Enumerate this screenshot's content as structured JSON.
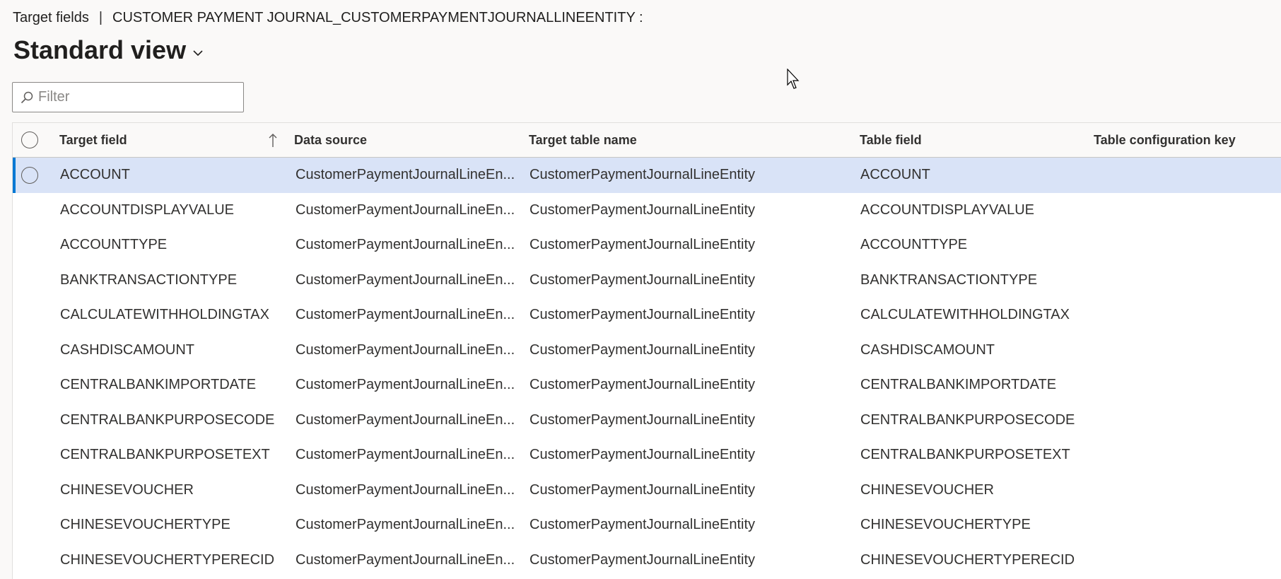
{
  "header": {
    "breadcrumb_first": "Target fields",
    "breadcrumb_separator": "|",
    "breadcrumb_second": "CUSTOMER PAYMENT JOURNAL_CUSTOMERPAYMENTJOURNALLINEENTITY :",
    "view_name": "Standard view"
  },
  "filter": {
    "placeholder": "Filter",
    "value": ""
  },
  "colors": {
    "selected_row": "#d9e3f7",
    "accent": "#0078d4"
  },
  "grid": {
    "columns": [
      "Target field",
      "Data source",
      "Target table name",
      "Table field",
      "Table configuration key"
    ],
    "sorted_column": "Target field",
    "sort_direction": "ascending",
    "rows": [
      {
        "target_field": "ACCOUNT",
        "data_source": "CustomerPaymentJournalLineEn...",
        "target_table": "CustomerPaymentJournalLineEntity",
        "table_field": "ACCOUNT",
        "config_key": "",
        "selected": true
      },
      {
        "target_field": "ACCOUNTDISPLAYVALUE",
        "data_source": "CustomerPaymentJournalLineEn...",
        "target_table": "CustomerPaymentJournalLineEntity",
        "table_field": "ACCOUNTDISPLAYVALUE",
        "config_key": ""
      },
      {
        "target_field": "ACCOUNTTYPE",
        "data_source": "CustomerPaymentJournalLineEn...",
        "target_table": "CustomerPaymentJournalLineEntity",
        "table_field": "ACCOUNTTYPE",
        "config_key": ""
      },
      {
        "target_field": "BANKTRANSACTIONTYPE",
        "data_source": "CustomerPaymentJournalLineEn...",
        "target_table": "CustomerPaymentJournalLineEntity",
        "table_field": "BANKTRANSACTIONTYPE",
        "config_key": ""
      },
      {
        "target_field": "CALCULATEWITHHOLDINGTAX",
        "data_source": "CustomerPaymentJournalLineEn...",
        "target_table": "CustomerPaymentJournalLineEntity",
        "table_field": "CALCULATEWITHHOLDINGTAX",
        "config_key": ""
      },
      {
        "target_field": "CASHDISCAMOUNT",
        "data_source": "CustomerPaymentJournalLineEn...",
        "target_table": "CustomerPaymentJournalLineEntity",
        "table_field": "CASHDISCAMOUNT",
        "config_key": ""
      },
      {
        "target_field": "CENTRALBANKIMPORTDATE",
        "data_source": "CustomerPaymentJournalLineEn...",
        "target_table": "CustomerPaymentJournalLineEntity",
        "table_field": "CENTRALBANKIMPORTDATE",
        "config_key": ""
      },
      {
        "target_field": "CENTRALBANKPURPOSECODE",
        "data_source": "CustomerPaymentJournalLineEn...",
        "target_table": "CustomerPaymentJournalLineEntity",
        "table_field": "CENTRALBANKPURPOSECODE",
        "config_key": ""
      },
      {
        "target_field": "CENTRALBANKPURPOSETEXT",
        "data_source": "CustomerPaymentJournalLineEn...",
        "target_table": "CustomerPaymentJournalLineEntity",
        "table_field": "CENTRALBANKPURPOSETEXT",
        "config_key": ""
      },
      {
        "target_field": "CHINESEVOUCHER",
        "data_source": "CustomerPaymentJournalLineEn...",
        "target_table": "CustomerPaymentJournalLineEntity",
        "table_field": "CHINESEVOUCHER",
        "config_key": ""
      },
      {
        "target_field": "CHINESEVOUCHERTYPE",
        "data_source": "CustomerPaymentJournalLineEn...",
        "target_table": "CustomerPaymentJournalLineEntity",
        "table_field": "CHINESEVOUCHERTYPE",
        "config_key": ""
      },
      {
        "target_field": "CHINESEVOUCHERTYPERECID",
        "data_source": "CustomerPaymentJournalLineEn...",
        "target_table": "CustomerPaymentJournalLineEntity",
        "table_field": "CHINESEVOUCHERTYPERECID",
        "config_key": ""
      }
    ]
  }
}
